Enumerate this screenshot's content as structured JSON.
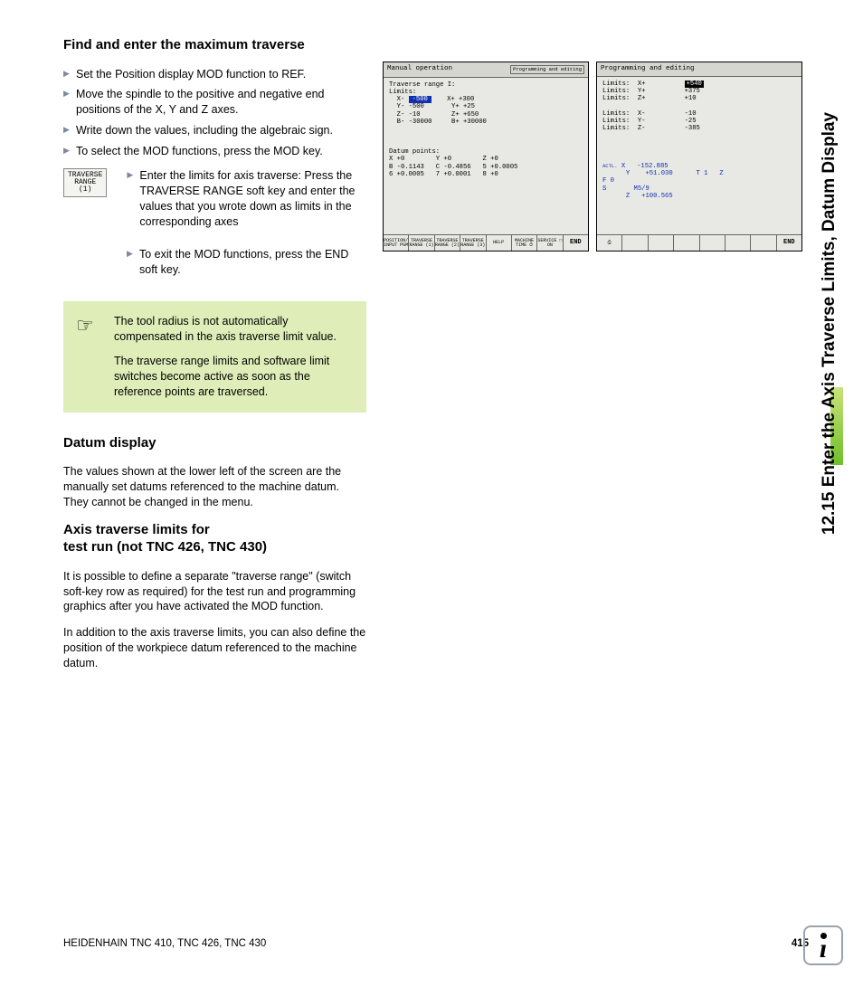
{
  "sideTab": "12.15 Enter the Axis Traverse Limits, Datum Display",
  "h1": "Find and enter the maximum traverse",
  "steps1": [
    "Set the Position display MOD function to REF.",
    "Move the spindle to the positive and negative end positions of the X, Y and Z axes.",
    "Write down the values, including the algebraic sign.",
    "To select the MOD functions, press the MOD key."
  ],
  "softkey": {
    "l1": "TRAVERSE",
    "l2": "RANGE",
    "l3": "(1)"
  },
  "subSteps": [
    "Enter the limits for axis traverse: Press the TRAVERSE RANGE soft key and enter the values that you wrote down as limits in the corresponding axes",
    "To exit the MOD functions, press the END soft key."
  ],
  "note": {
    "p1": "The tool radius is not automatically compensated in the axis traverse limit value.",
    "p2": "The traverse range limits and software limit switches become active as soon as the reference points are traversed."
  },
  "h2": "Datum display",
  "p2a": "The values shown at the lower left of the screen are the manually set datums referenced to the machine datum. They cannot be changed in the menu.",
  "h3a": "Axis traverse limits for",
  "h3b": "test run (not TNC 426, TNC 430)",
  "p3a": "It is possible to define a separate \"traverse range\" (switch soft-key row as required) for the test run and programming graphics after you have activated the MOD function.",
  "p3b": "In addition to the axis traverse limits, you can also define the position of the workpiece datum referenced to the machine datum.",
  "footer": {
    "left": "HEIDENHAIN TNC 410, TNC 426, TNC 430",
    "page": "415"
  },
  "screenA": {
    "title": "Manual operation",
    "mini": "Programming\nand editing",
    "body_l1": "Traverse range I:",
    "body_l2": "Limits:",
    "body_hl": "-500",
    "br1": "  X-            X+ +300",
    "br2": "  Y- -500       Y+ +25",
    "br3": "  Z- -10        Z+ +650",
    "br4": "  B- -30000     B+ +30000",
    "dp": "Datum points:",
    "dp1": "X +0        Y +0        Z +0",
    "dp2": "B -0.1143   C -0.4856   5 +0.0005",
    "dp3": "6 +0.0005   7 +0.0001   8 +0",
    "sk": [
      "POSITION/\nINPUT PGM",
      "TRAVERSE\nRANGE\n(1)",
      "TRAVERSE\nRANGE\n(2)",
      "TRAVERSE\nRANGE\n(3)",
      "HELP",
      "MACHINE\nTIME ⏱",
      "SERVICE\n□ ON",
      "END"
    ]
  },
  "screenB": {
    "title": "Programming and editing",
    "l1a": "Limits:  X+",
    "l1b": "+540",
    "l2": "Limits:  Y+          +375",
    "l3": "Limits:  Z+          +10",
    "l5": "Limits:  X-          -10",
    "l6": "Limits:  Y-          -25",
    "l7": "Limits:  Z-          -385",
    "actl": "ACTL.",
    "ax": "X   -152.885",
    "ay": "Y    +51.030",
    "az": "Z   +100.565",
    "st": "T 1   Z\nF 0\nS       M5/9",
    "sk_icon": "⎙",
    "end": "END"
  }
}
